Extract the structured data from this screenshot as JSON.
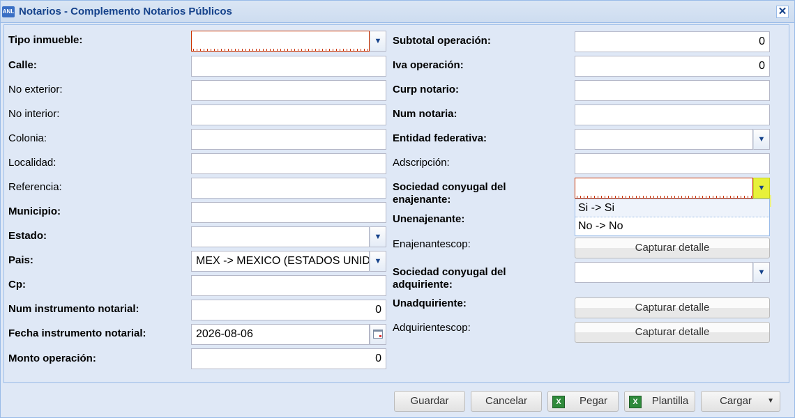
{
  "window": {
    "title": "Notarios - Complemento Notarios Públicos",
    "icon_text": "ANL",
    "close": "✕"
  },
  "left": {
    "tipo_inmueble": {
      "label": "Tipo inmueble:",
      "value": ""
    },
    "calle": {
      "label": "Calle:",
      "value": ""
    },
    "no_exterior": {
      "label": "No exterior:",
      "value": ""
    },
    "no_interior": {
      "label": "No interior:",
      "value": ""
    },
    "colonia": {
      "label": "Colonia:",
      "value": ""
    },
    "localidad": {
      "label": "Localidad:",
      "value": ""
    },
    "referencia": {
      "label": "Referencia:",
      "value": ""
    },
    "municipio": {
      "label": "Municipio:",
      "value": ""
    },
    "estado": {
      "label": "Estado:",
      "value": ""
    },
    "pais": {
      "label": "Pais:",
      "value": "MEX -> MEXICO (ESTADOS UNIDOS MEXICANOS)"
    },
    "cp": {
      "label": "Cp:",
      "value": ""
    },
    "num_instrumento": {
      "label": "Num instrumento notarial:",
      "value": "0"
    },
    "fecha_instrumento": {
      "label": "Fecha instrumento notarial:",
      "value": "2026-08-06"
    },
    "monto_operacion": {
      "label": "Monto operación:",
      "value": "0"
    }
  },
  "right": {
    "subtotal": {
      "label": "Subtotal operación:",
      "value": "0"
    },
    "iva": {
      "label": "Iva operación:",
      "value": "0"
    },
    "curp_notario": {
      "label": "Curp notario:",
      "value": ""
    },
    "num_notaria": {
      "label": "Num notaria:",
      "value": ""
    },
    "entidad_federativa": {
      "label": "Entidad federativa:",
      "value": ""
    },
    "adscripcion": {
      "label": "Adscripción:",
      "value": ""
    },
    "sociedad_enajenante": {
      "label_line1": "Sociedad conyugal del",
      "label_line2": "enajenante:",
      "value": ""
    },
    "unenajenante": {
      "label": "Unenajenante:"
    },
    "enajenantescop": {
      "label": "Enajenantescop:",
      "button": "Capturar detalle"
    },
    "sociedad_adquiriente": {
      "label_line1": "Sociedad conyugal del",
      "label_line2": "adquiriente:",
      "value": ""
    },
    "unadquiriente": {
      "label": "Unadquiriente:",
      "button": "Capturar detalle"
    },
    "adquirientescop": {
      "label": "Adquirientescop:",
      "button": "Capturar detalle"
    }
  },
  "dropdown": {
    "options": [
      "Si -> Si",
      "No -> No"
    ]
  },
  "footer": {
    "guardar": "Guardar",
    "cancelar": "Cancelar",
    "pegar": "Pegar",
    "plantilla": "Plantilla",
    "cargar": "Cargar",
    "excel_icon_text": "X"
  },
  "icons": {
    "trigger": "chevron-down-icon",
    "calendar": "calendar-icon",
    "excel": "excel-icon"
  }
}
